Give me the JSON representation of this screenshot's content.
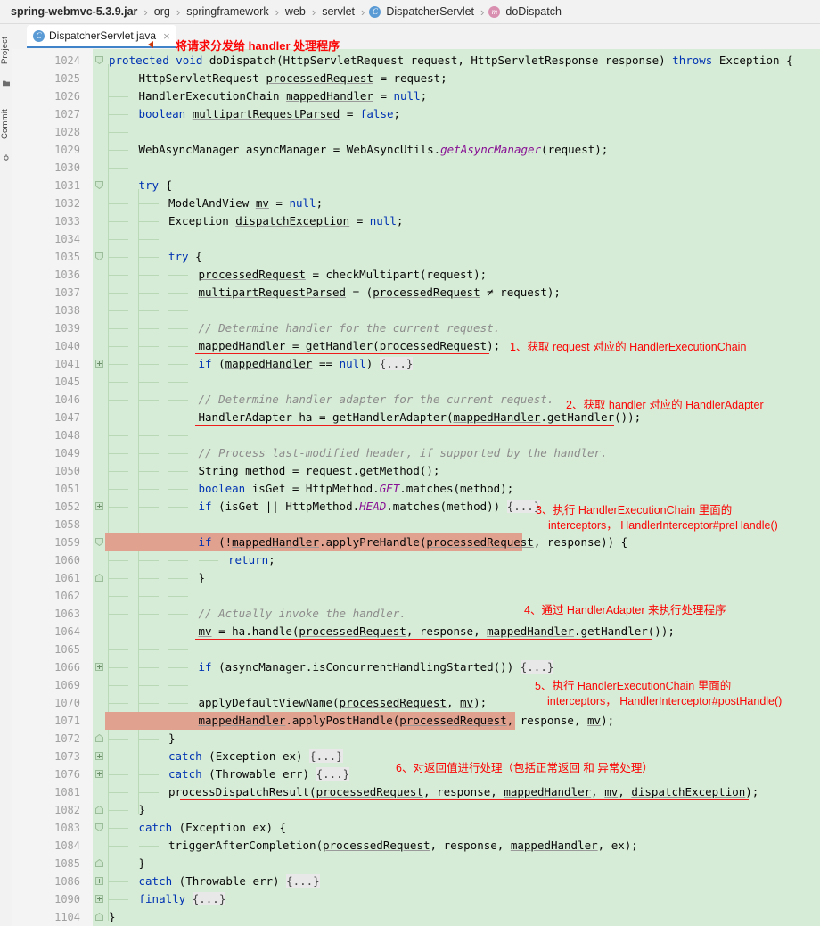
{
  "breadcrumb": {
    "items": [
      {
        "label": "spring-webmvc-5.3.9.jar",
        "badge": null
      },
      {
        "label": "org",
        "badge": null
      },
      {
        "label": "springframework",
        "badge": null
      },
      {
        "label": "web",
        "badge": null
      },
      {
        "label": "servlet",
        "badge": null
      },
      {
        "label": "DispatcherServlet",
        "badge": "C"
      },
      {
        "label": "doDispatch",
        "badge": "m"
      }
    ],
    "separator": "›"
  },
  "toolwindows": {
    "project_label": "Project",
    "commit_label": "Commit"
  },
  "tab": {
    "label": "DispatcherServlet.java",
    "badge": "C",
    "close": "×"
  },
  "title_annotation": "将请求分发给 handler 处理程序",
  "colors": {
    "code_background": "#d7ecd6",
    "highlight": "#e0a18f",
    "annotation_red": "#fa0505",
    "keyword_blue": "#0033b3",
    "comment_gray": "#8c8c8c",
    "gutter_background": "#f4f4f4"
  },
  "annotations": [
    {
      "id": "1",
      "lines": [
        "1、获取 request 对应的 HandlerExecutionChain"
      ]
    },
    {
      "id": "2",
      "lines": [
        "2、获取 handler 对应的 HandlerAdapter"
      ]
    },
    {
      "id": "3",
      "lines": [
        "3、执行 HandlerExecutionChain 里面的",
        "interceptors， HandlerInterceptor#preHandle()"
      ]
    },
    {
      "id": "4",
      "lines": [
        "4、通过 HandlerAdapter 来执行处理程序"
      ]
    },
    {
      "id": "5",
      "lines": [
        "5、执行 HandlerExecutionChain 里面的",
        "interceptors， HandlerInterceptor#postHandle()"
      ]
    },
    {
      "id": "6",
      "lines": [
        "6、对返回值进行处理（包括正常返回 和 异常处理）"
      ]
    }
  ],
  "code": {
    "lines": [
      {
        "n": "1024",
        "indent": 0,
        "fold": "open",
        "text": "protected void doDispatch(HttpServletRequest request, HttpServletResponse response) throws Exception {"
      },
      {
        "n": "1025",
        "indent": 1,
        "fold": null,
        "text": "HttpServletRequest processedRequest = request;"
      },
      {
        "n": "1026",
        "indent": 1,
        "fold": null,
        "text": "HandlerExecutionChain mappedHandler = null;"
      },
      {
        "n": "1027",
        "indent": 1,
        "fold": null,
        "text": "boolean multipartRequestParsed = false;"
      },
      {
        "n": "1028",
        "indent": 1,
        "fold": null,
        "text": ""
      },
      {
        "n": "1029",
        "indent": 1,
        "fold": null,
        "text": "WebAsyncManager asyncManager = WebAsyncUtils.getAsyncManager(request);"
      },
      {
        "n": "1030",
        "indent": 1,
        "fold": null,
        "text": ""
      },
      {
        "n": "1031",
        "indent": 1,
        "fold": "open",
        "text": "try {"
      },
      {
        "n": "1032",
        "indent": 2,
        "fold": null,
        "text": "ModelAndView mv = null;"
      },
      {
        "n": "1033",
        "indent": 2,
        "fold": null,
        "text": "Exception dispatchException = null;"
      },
      {
        "n": "1034",
        "indent": 2,
        "fold": null,
        "text": ""
      },
      {
        "n": "1035",
        "indent": 2,
        "fold": "open",
        "text": "try {"
      },
      {
        "n": "1036",
        "indent": 3,
        "fold": null,
        "text": "processedRequest = checkMultipart(request);"
      },
      {
        "n": "1037",
        "indent": 3,
        "fold": null,
        "text": "multipartRequestParsed = (processedRequest ≠ request);"
      },
      {
        "n": "1038",
        "indent": 3,
        "fold": null,
        "text": ""
      },
      {
        "n": "1039",
        "indent": 3,
        "fold": null,
        "text": "// Determine handler for the current request."
      },
      {
        "n": "1040",
        "indent": 3,
        "fold": null,
        "text": "mappedHandler = getHandler(processedRequest);"
      },
      {
        "n": "1041",
        "indent": 3,
        "fold": "collapsed",
        "text": "if (mappedHandler == null) {...}"
      },
      {
        "n": "1045",
        "indent": 3,
        "fold": null,
        "text": ""
      },
      {
        "n": "1046",
        "indent": 3,
        "fold": null,
        "text": "// Determine handler adapter for the current request."
      },
      {
        "n": "1047",
        "indent": 3,
        "fold": null,
        "text": "HandlerAdapter ha = getHandlerAdapter(mappedHandler.getHandler());"
      },
      {
        "n": "1048",
        "indent": 3,
        "fold": null,
        "text": ""
      },
      {
        "n": "1049",
        "indent": 3,
        "fold": null,
        "text": "// Process last-modified header, if supported by the handler."
      },
      {
        "n": "1050",
        "indent": 3,
        "fold": null,
        "text": "String method = request.getMethod();"
      },
      {
        "n": "1051",
        "indent": 3,
        "fold": null,
        "text": "boolean isGet = HttpMethod.GET.matches(method);"
      },
      {
        "n": "1052",
        "indent": 3,
        "fold": "collapsed",
        "text": "if (isGet || HttpMethod.HEAD.matches(method)) {...}"
      },
      {
        "n": "1058",
        "indent": 3,
        "fold": null,
        "text": ""
      },
      {
        "n": "1059",
        "indent": 3,
        "fold": "open",
        "text": "if (!mappedHandler.applyPreHandle(processedRequest, response)) {"
      },
      {
        "n": "1060",
        "indent": 4,
        "fold": null,
        "text": "return;"
      },
      {
        "n": "1061",
        "indent": 3,
        "fold": "close",
        "text": "}"
      },
      {
        "n": "1062",
        "indent": 3,
        "fold": null,
        "text": ""
      },
      {
        "n": "1063",
        "indent": 3,
        "fold": null,
        "text": "// Actually invoke the handler."
      },
      {
        "n": "1064",
        "indent": 3,
        "fold": null,
        "text": "mv = ha.handle(processedRequest, response, mappedHandler.getHandler());"
      },
      {
        "n": "1065",
        "indent": 3,
        "fold": null,
        "text": ""
      },
      {
        "n": "1066",
        "indent": 3,
        "fold": "collapsed",
        "text": "if (asyncManager.isConcurrentHandlingStarted()) {...}"
      },
      {
        "n": "1069",
        "indent": 3,
        "fold": null,
        "text": ""
      },
      {
        "n": "1070",
        "indent": 3,
        "fold": null,
        "text": "applyDefaultViewName(processedRequest, mv);"
      },
      {
        "n": "1071",
        "indent": 3,
        "fold": null,
        "text": "mappedHandler.applyPostHandle(processedRequest, response, mv);"
      },
      {
        "n": "1072",
        "indent": 2,
        "fold": "close",
        "text": "}"
      },
      {
        "n": "1073",
        "indent": 2,
        "fold": "collapsed",
        "text": "catch (Exception ex) {...}"
      },
      {
        "n": "1076",
        "indent": 2,
        "fold": "collapsed",
        "text": "catch (Throwable err) {...}"
      },
      {
        "n": "1081",
        "indent": 2,
        "fold": null,
        "text": "processDispatchResult(processedRequest, response, mappedHandler, mv, dispatchException);"
      },
      {
        "n": "1082",
        "indent": 1,
        "fold": "close",
        "text": "}"
      },
      {
        "n": "1083",
        "indent": 1,
        "fold": "open",
        "text": "catch (Exception ex) {"
      },
      {
        "n": "1084",
        "indent": 2,
        "fold": null,
        "text": "triggerAfterCompletion(processedRequest, response, mappedHandler, ex);"
      },
      {
        "n": "1085",
        "indent": 1,
        "fold": "close",
        "text": "}"
      },
      {
        "n": "1086",
        "indent": 1,
        "fold": "collapsed",
        "text": "catch (Throwable err) {...}"
      },
      {
        "n": "1090",
        "indent": 1,
        "fold": "collapsed",
        "text": "finally {...}"
      },
      {
        "n": "1104",
        "indent": 0,
        "fold": "close",
        "text": "}"
      }
    ]
  }
}
